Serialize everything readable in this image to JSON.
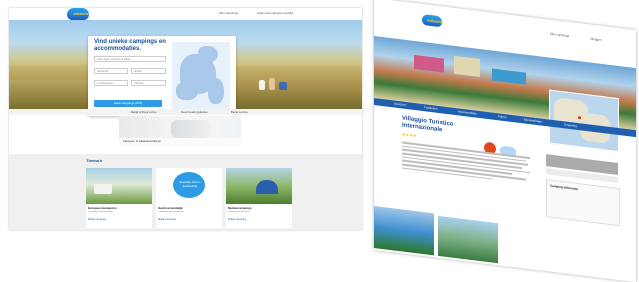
{
  "left_screen": {
    "logo_text": "vakantie",
    "nav": [
      "Mijn campings",
      "Zoek naar kampeer-verblijf",
      "Inloggen"
    ],
    "hero_heading": "Vind unieke campings en accommodaties.",
    "search": {
      "destination_placeholder": "Land, regio, camping of plaats",
      "arrival_placeholder": "Aankomst",
      "departure_placeholder": "Vertrek",
      "guests_value": "2 volwassenen",
      "accommodation_value": "Caravan",
      "cta_label": "Zoek campings (873)"
    },
    "checks": [
      "Bekijk & Boek online",
      "Geen boekingskosten",
      "Beste service"
    ],
    "banner_title": "Kampeer- & vakantieverblijven",
    "themes": {
      "title": "Thema's",
      "cards": [
        {
          "title": "Europees kamperen",
          "sub": "Campings in heel Europa",
          "link": "Bekijk campings"
        },
        {
          "title": "Gezinsvriendelijk",
          "sub": "Campings met speeltuinen",
          "link": "Bekijk campings"
        },
        {
          "title": "Natuurcampings",
          "sub": "Campings in de natuur",
          "link": "Bekijk campings"
        }
      ],
      "badge_text": "Speciale zomer-aanbieding"
    }
  },
  "right_screen": {
    "logo_text": "vakantie",
    "nav": [
      "Mijn campings",
      "Inloggen"
    ],
    "tabs": [
      "Overzicht",
      "Faciliteiten",
      "Accommodatie",
      "Prijzen",
      "Beoordelingen",
      "Omgeving"
    ],
    "title": "Villaggio Turistico Internazionale",
    "stars": "★★★★",
    "booking_box_title": "Camping informatie",
    "colors": {
      "accent": "#1a4e9c",
      "tab_bar": "#1f5fb0",
      "cta": "#2e9ce4"
    }
  }
}
